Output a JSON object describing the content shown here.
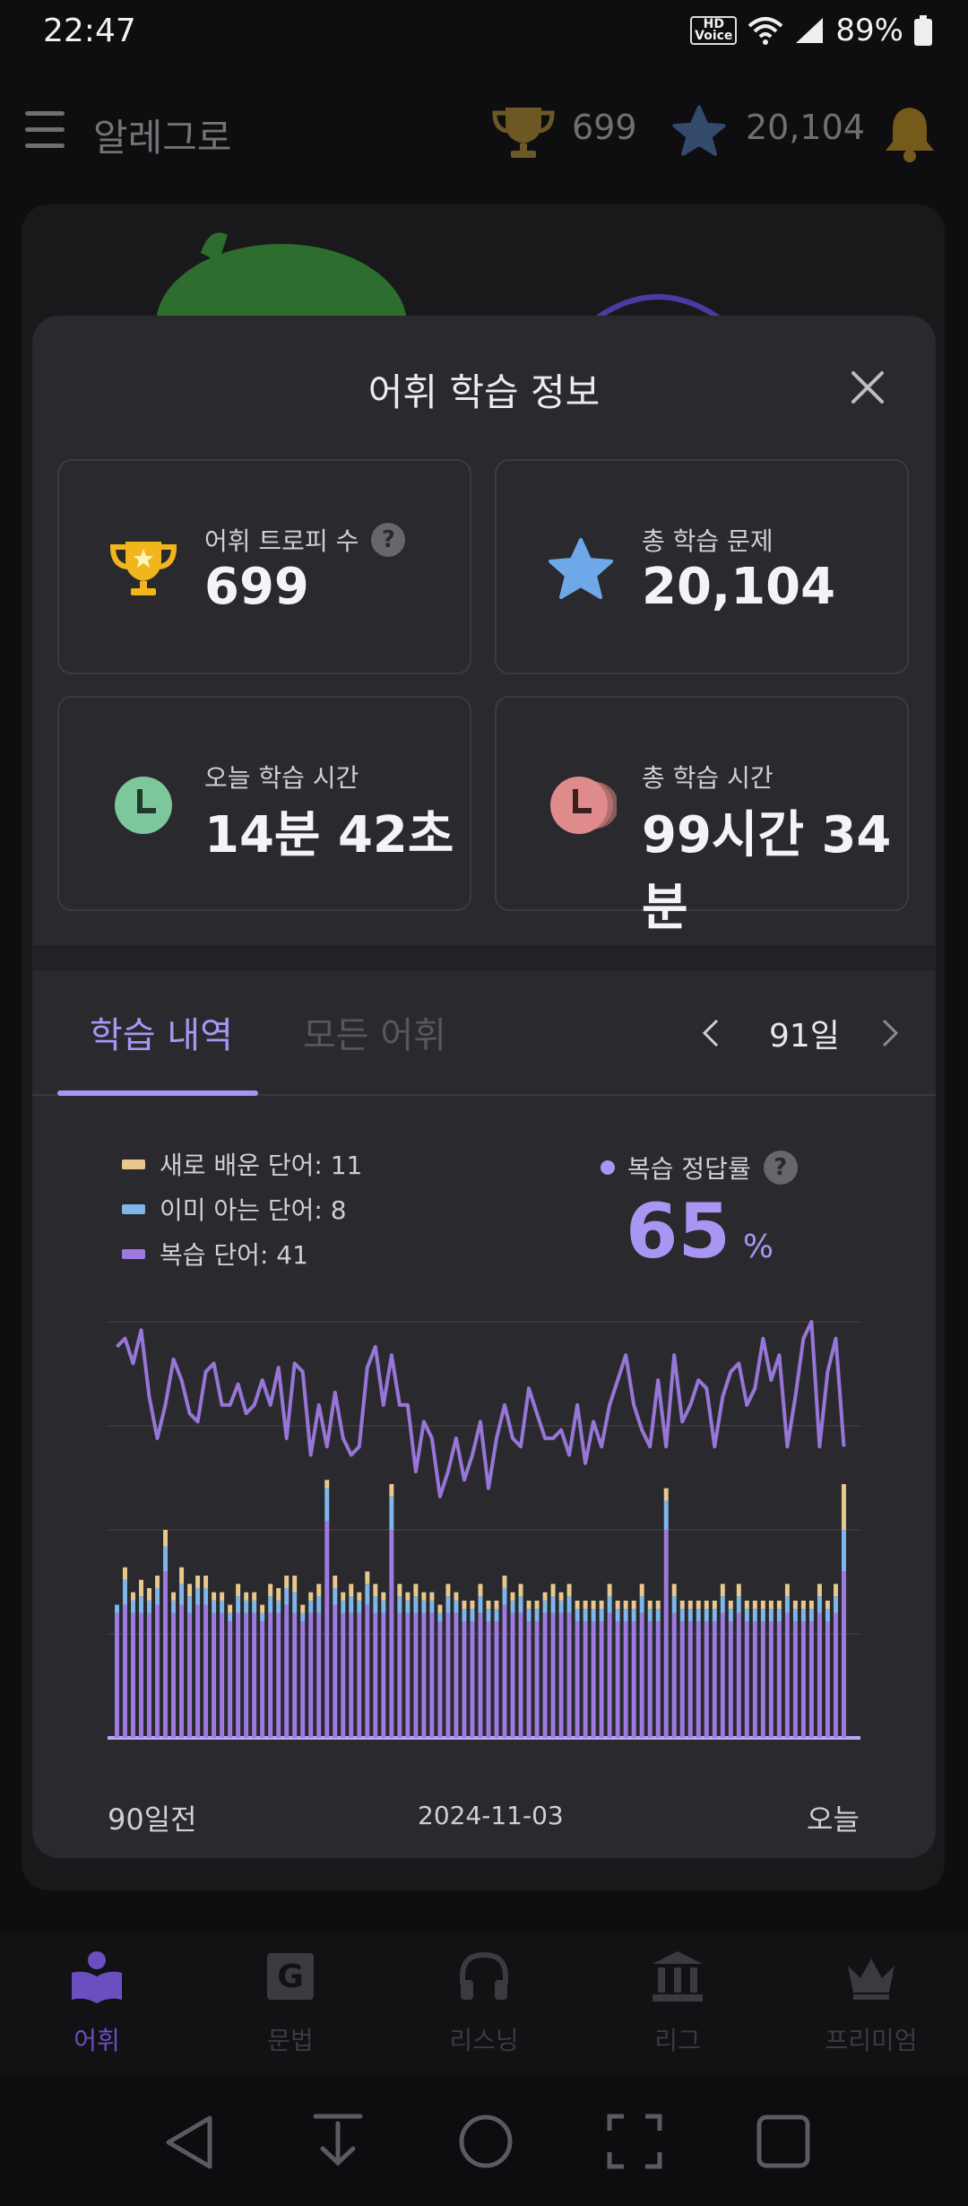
{
  "status_bar": {
    "time": "22:47",
    "hd_label": "HD Voice",
    "battery": "89%"
  },
  "app_bar": {
    "title": "알레그로",
    "trophy_count": "699",
    "star_count": "20,104"
  },
  "modal": {
    "title": "어휘 학습 정보",
    "cards": [
      {
        "label": "어휘 트로피 수",
        "value": "699",
        "help": "?"
      },
      {
        "label": "총 학습 문제",
        "value": "20,104"
      },
      {
        "label": "오늘 학습 시간",
        "value": "14분 42초"
      },
      {
        "label": "총 학습 시간",
        "value": "99시간 34분"
      }
    ],
    "tabs": {
      "active": "학습 내역",
      "inactive": "모든 어휘"
    },
    "period": "91일",
    "legend": [
      {
        "label": "새로 배운 단어: 11",
        "color": "#e8c88c"
      },
      {
        "label": "이미 아는 단어: 8",
        "color": "#7fb6ea"
      },
      {
        "label": "복습 단어: 41",
        "color": "#9d7ae0"
      }
    ],
    "accuracy": {
      "label": "복습 정답률",
      "value": "65",
      "unit": "%",
      "help": "?"
    },
    "x_labels": {
      "start": "90일전",
      "middle": "2024-11-03",
      "end": "오늘"
    }
  },
  "chart_data": {
    "type": "bar",
    "stacked": true,
    "categories_count": 91,
    "series": [
      {
        "name": "복습 단어",
        "color": "#9d7ae0",
        "values": [
          30,
          32,
          30,
          30,
          30,
          32,
          40,
          30,
          32,
          30,
          32,
          32,
          30,
          30,
          28,
          30,
          30,
          30,
          28,
          30,
          30,
          32,
          30,
          28,
          30,
          30,
          52,
          32,
          30,
          30,
          30,
          32,
          30,
          30,
          50,
          30,
          30,
          30,
          30,
          30,
          28,
          30,
          30,
          28,
          28,
          30,
          28,
          28,
          32,
          30,
          30,
          28,
          28,
          30,
          30,
          30,
          30,
          28,
          28,
          28,
          28,
          30,
          28,
          28,
          28,
          30,
          28,
          28,
          50,
          30,
          28,
          28,
          28,
          28,
          28,
          30,
          28,
          30,
          28,
          28,
          28,
          28,
          28,
          30,
          28,
          28,
          28,
          30,
          28,
          30,
          40
        ]
      },
      {
        "name": "이미 아는 단어",
        "color": "#7fb6ea",
        "values": [
          2,
          6,
          3,
          4,
          3,
          4,
          6,
          3,
          5,
          4,
          4,
          4,
          3,
          3,
          2,
          4,
          3,
          3,
          2,
          4,
          3,
          4,
          5,
          2,
          3,
          4,
          8,
          4,
          3,
          4,
          3,
          5,
          4,
          3,
          8,
          4,
          3,
          4,
          3,
          3,
          2,
          4,
          3,
          3,
          3,
          4,
          3,
          3,
          4,
          3,
          4,
          3,
          3,
          3,
          4,
          3,
          4,
          3,
          3,
          3,
          3,
          4,
          3,
          3,
          3,
          4,
          3,
          3,
          7,
          4,
          3,
          3,
          3,
          3,
          3,
          4,
          3,
          4,
          3,
          3,
          3,
          3,
          3,
          4,
          3,
          3,
          3,
          4,
          3,
          4,
          10
        ]
      },
      {
        "name": "새로 배운 단어",
        "color": "#e8c88c",
        "values": [
          0,
          3,
          2,
          4,
          3,
          3,
          4,
          2,
          4,
          3,
          3,
          3,
          2,
          2,
          2,
          3,
          2,
          2,
          2,
          3,
          3,
          3,
          4,
          2,
          2,
          3,
          2,
          3,
          2,
          3,
          2,
          3,
          3,
          2,
          3,
          3,
          2,
          3,
          2,
          2,
          2,
          3,
          2,
          2,
          2,
          3,
          2,
          2,
          3,
          2,
          3,
          2,
          2,
          2,
          3,
          2,
          3,
          2,
          2,
          2,
          2,
          3,
          2,
          2,
          2,
          3,
          2,
          2,
          3,
          3,
          2,
          2,
          2,
          2,
          2,
          3,
          2,
          3,
          2,
          2,
          2,
          2,
          2,
          3,
          2,
          2,
          2,
          3,
          2,
          3,
          11
        ]
      },
      {
        "name": "복습 정답률",
        "color": "#9d7ae0",
        "type": "line",
        "values": [
          94,
          96,
          90,
          98,
          82,
          72,
          80,
          91,
          86,
          78,
          76,
          88,
          90,
          80,
          80,
          85,
          78,
          80,
          86,
          80,
          89,
          72,
          90,
          88,
          68,
          80,
          70,
          83,
          72,
          68,
          70,
          89,
          94,
          80,
          92,
          80,
          80,
          64,
          76,
          72,
          58,
          64,
          72,
          62,
          68,
          76,
          60,
          72,
          80,
          72,
          70,
          84,
          78,
          72,
          72,
          74,
          68,
          80,
          66,
          76,
          70,
          80,
          86,
          92,
          80,
          74,
          70,
          86,
          70,
          92,
          76,
          80,
          86,
          84,
          70,
          82,
          88,
          90,
          80,
          84,
          96,
          86,
          92,
          70,
          82,
          96,
          100,
          70,
          88,
          96,
          70
        ]
      }
    ],
    "ylim": [
      0,
      100
    ]
  },
  "bottom_nav": [
    {
      "label": "어휘"
    },
    {
      "label": "문법"
    },
    {
      "label": "리스닝"
    },
    {
      "label": "리그"
    },
    {
      "label": "프리미엄"
    }
  ]
}
